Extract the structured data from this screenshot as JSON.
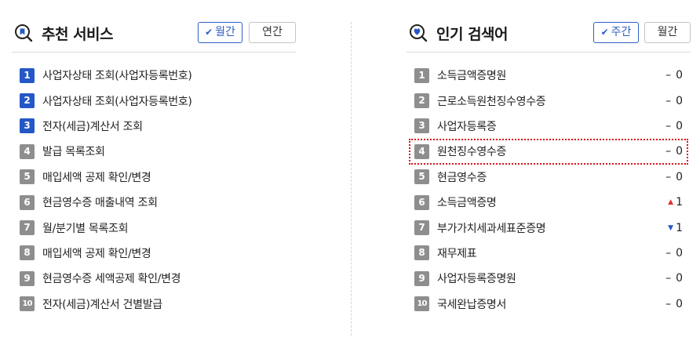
{
  "recommended": {
    "title": "추천 서비스",
    "icon": "bookmark-search-icon",
    "tab_monthly": "월간",
    "tab_yearly": "연간",
    "items": [
      {
        "rank": "1",
        "label": "사업자상태 조회(사업자등록번호)",
        "highlight": true
      },
      {
        "rank": "2",
        "label": "사업자상태 조회(사업자등록번호)",
        "highlight": true
      },
      {
        "rank": "3",
        "label": "전자(세금)계산서 조회",
        "highlight": true
      },
      {
        "rank": "4",
        "label": "발급 목록조회",
        "highlight": false
      },
      {
        "rank": "5",
        "label": "매입세액 공제 확인/변경",
        "highlight": false
      },
      {
        "rank": "6",
        "label": "현금영수증 매출내역 조회",
        "highlight": false
      },
      {
        "rank": "7",
        "label": "월/분기별 목록조회",
        "highlight": false
      },
      {
        "rank": "8",
        "label": "매입세액 공제 확인/변경",
        "highlight": false
      },
      {
        "rank": "9",
        "label": "현금영수증 세액공제 확인/변경",
        "highlight": false
      },
      {
        "rank": "10",
        "label": "전자(세금)계산서 건별발급",
        "highlight": false
      }
    ]
  },
  "popular": {
    "title": "인기 검색어",
    "icon": "heart-search-icon",
    "tab_weekly": "주간",
    "tab_monthly": "월간",
    "items": [
      {
        "rank": "1",
        "label": "소득금액증명원",
        "trend": "none",
        "change": "0"
      },
      {
        "rank": "2",
        "label": "근로소득원천징수영수증",
        "trend": "none",
        "change": "0"
      },
      {
        "rank": "3",
        "label": "사업자등록증",
        "trend": "none",
        "change": "0"
      },
      {
        "rank": "4",
        "label": "원천징수영수증",
        "trend": "none",
        "change": "0"
      },
      {
        "rank": "5",
        "label": "현금영수증",
        "trend": "none",
        "change": "0"
      },
      {
        "rank": "6",
        "label": "소득금액증명",
        "trend": "up",
        "change": "1"
      },
      {
        "rank": "7",
        "label": "부가가치세과세표준증명",
        "trend": "down",
        "change": "1"
      },
      {
        "rank": "8",
        "label": "재무제표",
        "trend": "none",
        "change": "0"
      },
      {
        "rank": "9",
        "label": "사업자등록증명원",
        "trend": "none",
        "change": "0"
      },
      {
        "rank": "10",
        "label": "국세완납증명서",
        "trend": "none",
        "change": "0"
      }
    ]
  },
  "colors": {
    "accent": "#2d5fc4",
    "rank_highlight": "#2557c7",
    "rank_default": "#8e8e8e",
    "trend_up": "#e0322f",
    "trend_down": "#2557c7",
    "focus_outline": "#d8131b"
  }
}
